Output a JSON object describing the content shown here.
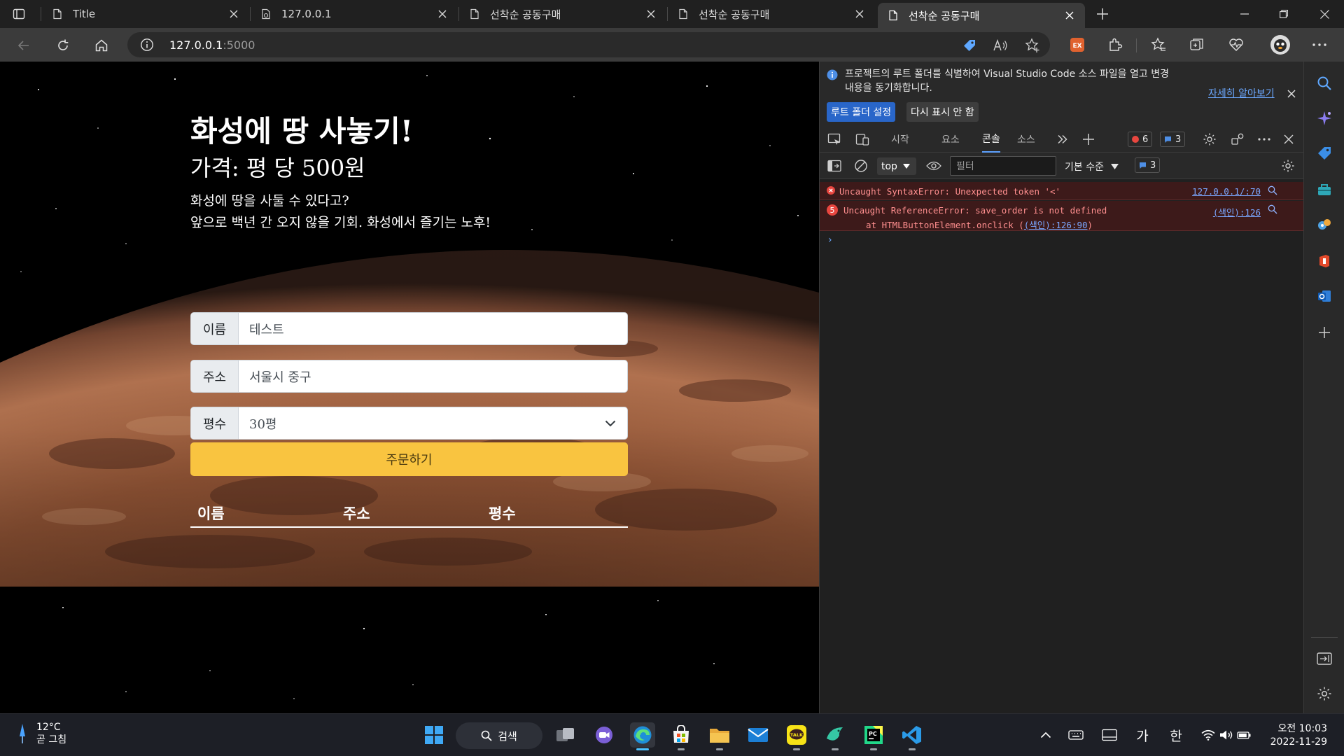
{
  "browser": {
    "tabs": [
      {
        "title": "Title",
        "active": false
      },
      {
        "title": "127.0.0.1",
        "active": false
      },
      {
        "title": "선착순 공동구매",
        "active": false
      },
      {
        "title": "선착순 공동구매",
        "active": false
      },
      {
        "title": "선착순 공동구매",
        "active": true
      }
    ],
    "url_host": "127.0.0.1",
    "url_port": ":5000"
  },
  "page": {
    "title": "화성에 땅 사놓기!",
    "price": "가격: 평 당 500원",
    "desc_line1": "화성에 땅을 사둘 수 있다고?",
    "desc_line2": "앞으로 백년 간 오지 않을 기회. 화성에서 즐기는 노후!",
    "form": {
      "name_label": "이름",
      "name_value": "테스트",
      "address_label": "주소",
      "address_value": "서울시 중구",
      "size_label": "평수",
      "size_value": "30평"
    },
    "order_button": "주문하기",
    "table_headers": [
      "이름",
      "주소",
      "평수"
    ]
  },
  "devtools": {
    "banner_line1": "프로젝트의 루트 폴더를 식별하여 Visual Studio Code 소스 파일을 열고 변경",
    "banner_line2": "내용을 동기화합니다.",
    "learn_more": "자세히 알아보기",
    "set_root_button": "루트 폴더 설정",
    "dont_show_button": "다시 표시 안 함",
    "tabs": [
      "시작",
      "요소",
      "콘솔",
      "소스"
    ],
    "active_tab": "콘솔",
    "error_count": "6",
    "message_count": "3",
    "context": "top",
    "filter_placeholder": "필터",
    "levels": "기본 수준",
    "levels_count": "3",
    "errors": [
      {
        "icon_text": "",
        "message": "Uncaught SyntaxError: Unexpected token '<'",
        "source": "127.0.0.1/:70"
      },
      {
        "icon_text": "5",
        "message": "Uncaught ReferenceError: save_order is not defined",
        "sub_prefix": "at HTMLButtonElement.onclick (",
        "sub_link": "(색인):126:90",
        "sub_suffix": ")",
        "source": "(색인):126"
      }
    ],
    "prompt": "›"
  },
  "taskbar": {
    "temperature": "12°C",
    "weather_desc": "곧 그침",
    "search_label": "검색",
    "ime_hangul1": "가",
    "ime_hangul2": "한",
    "time": "오전 10:03",
    "date": "2022-11-29"
  },
  "colors": {
    "order_button": "#f9c440",
    "link": "#6ba8ff",
    "error_bg": "#3d1a1a",
    "error_text": "#ff8f8f",
    "accent": "#2966c9"
  },
  "icons": {
    "tab_actions": "tab-actions-icon",
    "page_icon": "document-icon",
    "close": "close-icon",
    "back": "back-arrow-icon",
    "refresh": "refresh-icon",
    "home": "home-icon",
    "info": "info-icon"
  }
}
